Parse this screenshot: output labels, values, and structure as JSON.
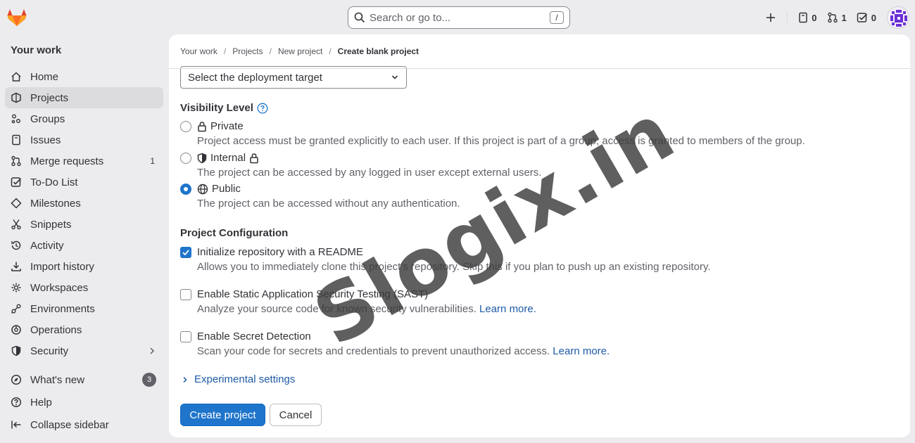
{
  "topbar": {
    "search_placeholder": "Search or go to...",
    "search_shortcut": "/",
    "issues_count": "0",
    "merge_requests_count": "1",
    "todos_count": "0"
  },
  "sidebar": {
    "title": "Your work",
    "items": [
      {
        "label": "Home",
        "icon": "home-icon"
      },
      {
        "label": "Projects",
        "icon": "project-icon",
        "active": true
      },
      {
        "label": "Groups",
        "icon": "group-icon"
      },
      {
        "label": "Issues",
        "icon": "issues-icon"
      },
      {
        "label": "Merge requests",
        "icon": "merge-request-icon",
        "count": "1"
      },
      {
        "label": "To-Do List",
        "icon": "todo-icon"
      },
      {
        "label": "Milestones",
        "icon": "milestone-icon"
      },
      {
        "label": "Snippets",
        "icon": "snippet-icon"
      },
      {
        "label": "Activity",
        "icon": "history-icon"
      },
      {
        "label": "Import history",
        "icon": "import-icon"
      },
      {
        "label": "Workspaces",
        "icon": "workspace-icon"
      },
      {
        "label": "Environments",
        "icon": "environment-icon"
      },
      {
        "label": "Operations",
        "icon": "operations-icon"
      },
      {
        "label": "Security",
        "icon": "shield-icon"
      }
    ],
    "bottom": {
      "whats_new": "What's new",
      "whats_new_count": "3",
      "help": "Help",
      "collapse": "Collapse sidebar"
    }
  },
  "breadcrumb": [
    "Your work",
    "Projects",
    "New project",
    "Create blank project"
  ],
  "form": {
    "deployment_select": "Select the deployment target",
    "visibility_heading": "Visibility Level",
    "visibility": [
      {
        "label": "Private",
        "help": "Project access must be granted explicitly to each user. If this project is part of a group, access is granted to members of the group.",
        "selected": false
      },
      {
        "label": "Internal",
        "help": "The project can be accessed by any logged in user except external users.",
        "selected": false
      },
      {
        "label": "Public",
        "help": "The project can be accessed without any authentication.",
        "selected": true
      }
    ],
    "config_heading": "Project Configuration",
    "config": [
      {
        "label": "Initialize repository with a README",
        "help": "Allows you to immediately clone this project’s repository. Skip this if you plan to push up an existing repository.",
        "checked": true
      },
      {
        "label": "Enable Static Application Security Testing (SAST)",
        "help": "Analyze your source code for known security vulnerabilities.",
        "link": "Learn more.",
        "checked": false
      },
      {
        "label": "Enable Secret Detection",
        "help": "Scan your code for secrets and credentials to prevent unauthorized access.",
        "link": "Learn more.",
        "checked": false
      }
    ],
    "experimental": "Experimental settings",
    "create_button": "Create project",
    "cancel_button": "Cancel"
  },
  "watermark": "Slogix.in",
  "colors": {
    "primary": "#1f75cb",
    "link": "#1f5ba6",
    "logo": "#e24329"
  }
}
